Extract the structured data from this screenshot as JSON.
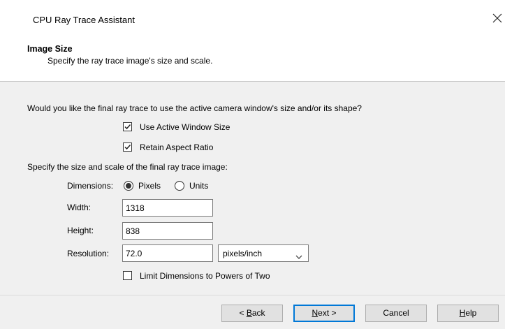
{
  "window": {
    "title": "CPU Ray Trace Assistant"
  },
  "header": {
    "title": "Image Size",
    "subtitle": "Specify the ray trace image's size and scale."
  },
  "question": "Would you like the final ray trace to use the active camera window's size and/or its shape?",
  "options": {
    "use_active_window_size": {
      "label": "Use Active Window Size",
      "checked": true
    },
    "retain_aspect_ratio": {
      "label": "Retain Aspect Ratio",
      "checked": true
    }
  },
  "size_prompt": "Specify the size and scale of the final ray trace image:",
  "dimensions": {
    "label": "Dimensions:",
    "pixels_label": "Pixels",
    "units_label": "Units",
    "selected": "Pixels"
  },
  "width": {
    "label": "Width:",
    "value": "1318"
  },
  "height": {
    "label": "Height:",
    "value": "838"
  },
  "resolution": {
    "label": "Resolution:",
    "value": "72.0",
    "unit": "pixels/inch"
  },
  "limit_powers": {
    "label": "Limit Dimensions to Powers of Two",
    "checked": false
  },
  "buttons": {
    "back_prefix": "< ",
    "back_mnemonic": "B",
    "back_rest": "ack",
    "next_mnemonic": "N",
    "next_rest": "ext >",
    "cancel": "Cancel",
    "help_mnemonic": "H",
    "help_rest": "elp"
  },
  "colors": {
    "accent": "#0078d7"
  }
}
